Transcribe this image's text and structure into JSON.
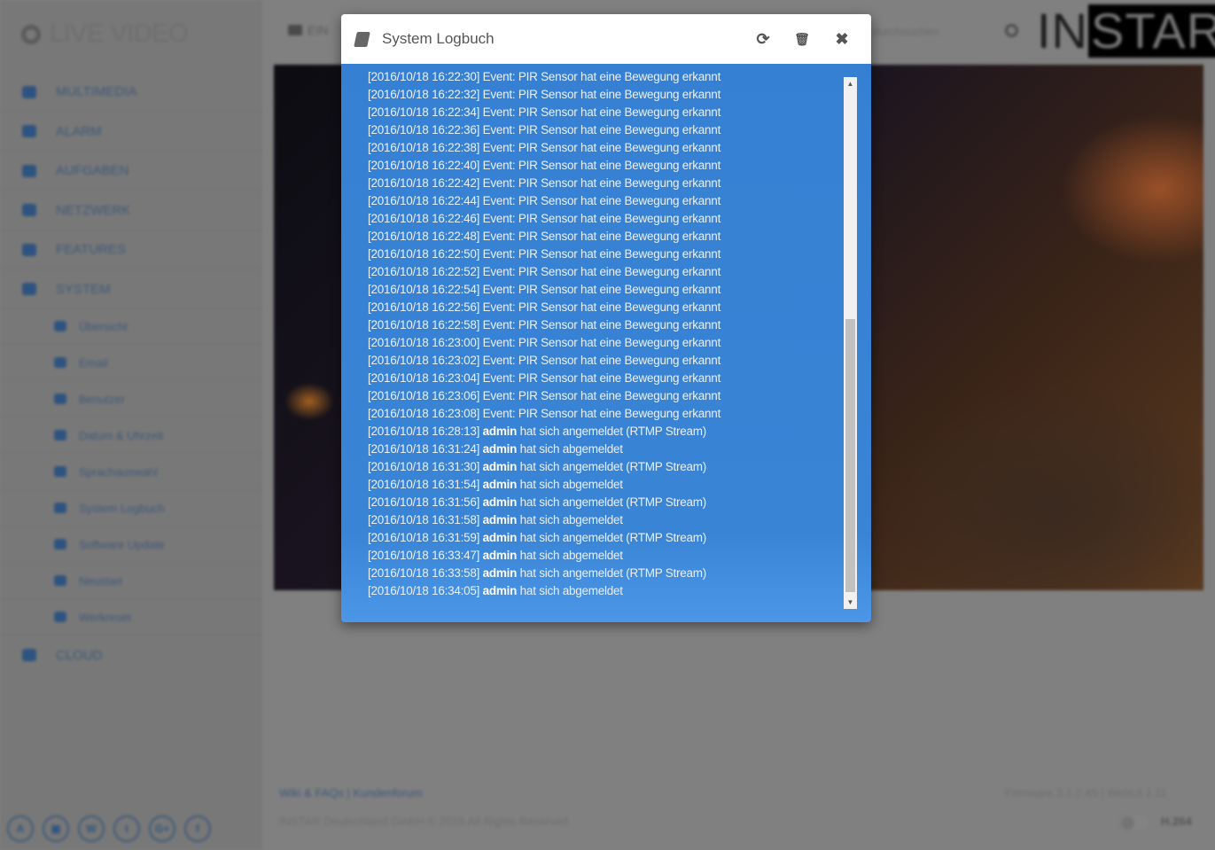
{
  "sidebar": {
    "logo": "LIVE VIDEO",
    "items": [
      {
        "label": "MULTIMEDIA",
        "icon": "image-icon"
      },
      {
        "label": "ALARM",
        "icon": "bell-icon"
      },
      {
        "label": "AUFGABEN",
        "icon": "film-icon"
      },
      {
        "label": "NETZWERK",
        "icon": "sitemap-icon"
      },
      {
        "label": "FEATURES",
        "icon": "circle-icon"
      },
      {
        "label": "SYSTEM",
        "icon": "gear-icon"
      }
    ],
    "system_sub": [
      {
        "label": "Übersicht",
        "icon": "desktop-icon"
      },
      {
        "label": "Email",
        "icon": "envelope-icon"
      },
      {
        "label": "Benutzer",
        "icon": "user-icon"
      },
      {
        "label": "Datum & Uhrzeit",
        "icon": "clock-icon"
      },
      {
        "label": "Sprachauswahl",
        "icon": "globe-icon"
      },
      {
        "label": "System Logbuch",
        "icon": "book-icon"
      },
      {
        "label": "Software Update",
        "icon": "refresh-icon"
      },
      {
        "label": "Neustart",
        "icon": "power-icon"
      },
      {
        "label": "Werkreset",
        "icon": "wrench-icon"
      }
    ],
    "cloud": "CLOUD",
    "social": [
      "A",
      "▣",
      "W",
      "t",
      "G+",
      "f"
    ]
  },
  "topbar": {
    "tab": "EIN",
    "search": "durchsuchen",
    "brand_a": "IN",
    "brand_b": "STAR"
  },
  "footer": {
    "links": "Wiki & FAQs | Kundenforum",
    "copyright": "INSTAR Deutschland GmbH © 2016 All Rights Reserved",
    "version": "Firmware 3.1.2.45 | WebUI 1.11",
    "codec": "H.264"
  },
  "modal": {
    "title": "System Logbuch",
    "refresh_icon": "⟳",
    "trash_icon": "🗑",
    "close_icon": "✖",
    "log": [
      {
        "ts": "[2016/10/18 16:22:30]",
        "user": "",
        "msg": "Event: PIR Sensor hat eine Bewegung erkannt"
      },
      {
        "ts": "[2016/10/18 16:22:32]",
        "user": "",
        "msg": "Event: PIR Sensor hat eine Bewegung erkannt"
      },
      {
        "ts": "[2016/10/18 16:22:34]",
        "user": "",
        "msg": "Event: PIR Sensor hat eine Bewegung erkannt"
      },
      {
        "ts": "[2016/10/18 16:22:36]",
        "user": "",
        "msg": "Event: PIR Sensor hat eine Bewegung erkannt"
      },
      {
        "ts": "[2016/10/18 16:22:38]",
        "user": "",
        "msg": "Event: PIR Sensor hat eine Bewegung erkannt"
      },
      {
        "ts": "[2016/10/18 16:22:40]",
        "user": "",
        "msg": "Event: PIR Sensor hat eine Bewegung erkannt"
      },
      {
        "ts": "[2016/10/18 16:22:42]",
        "user": "",
        "msg": "Event: PIR Sensor hat eine Bewegung erkannt"
      },
      {
        "ts": "[2016/10/18 16:22:44]",
        "user": "",
        "msg": "Event: PIR Sensor hat eine Bewegung erkannt"
      },
      {
        "ts": "[2016/10/18 16:22:46]",
        "user": "",
        "msg": "Event: PIR Sensor hat eine Bewegung erkannt"
      },
      {
        "ts": "[2016/10/18 16:22:48]",
        "user": "",
        "msg": "Event: PIR Sensor hat eine Bewegung erkannt"
      },
      {
        "ts": "[2016/10/18 16:22:50]",
        "user": "",
        "msg": "Event: PIR Sensor hat eine Bewegung erkannt"
      },
      {
        "ts": "[2016/10/18 16:22:52]",
        "user": "",
        "msg": "Event: PIR Sensor hat eine Bewegung erkannt"
      },
      {
        "ts": "[2016/10/18 16:22:54]",
        "user": "",
        "msg": "Event: PIR Sensor hat eine Bewegung erkannt"
      },
      {
        "ts": "[2016/10/18 16:22:56]",
        "user": "",
        "msg": "Event: PIR Sensor hat eine Bewegung erkannt"
      },
      {
        "ts": "[2016/10/18 16:22:58]",
        "user": "",
        "msg": "Event: PIR Sensor hat eine Bewegung erkannt"
      },
      {
        "ts": "[2016/10/18 16:23:00]",
        "user": "",
        "msg": "Event: PIR Sensor hat eine Bewegung erkannt"
      },
      {
        "ts": "[2016/10/18 16:23:02]",
        "user": "",
        "msg": "Event: PIR Sensor hat eine Bewegung erkannt"
      },
      {
        "ts": "[2016/10/18 16:23:04]",
        "user": "",
        "msg": "Event: PIR Sensor hat eine Bewegung erkannt"
      },
      {
        "ts": "[2016/10/18 16:23:06]",
        "user": "",
        "msg": "Event: PIR Sensor hat eine Bewegung erkannt"
      },
      {
        "ts": "[2016/10/18 16:23:08]",
        "user": "",
        "msg": "Event: PIR Sensor hat eine Bewegung erkannt"
      },
      {
        "ts": "[2016/10/18 16:28:13]",
        "user": "admin",
        "msg": "hat sich angemeldet (RTMP Stream)"
      },
      {
        "ts": "[2016/10/18 16:31:24]",
        "user": "admin",
        "msg": "hat sich abgemeldet"
      },
      {
        "ts": "[2016/10/18 16:31:30]",
        "user": "admin",
        "msg": "hat sich angemeldet (RTMP Stream)"
      },
      {
        "ts": "[2016/10/18 16:31:54]",
        "user": "admin",
        "msg": "hat sich abgemeldet"
      },
      {
        "ts": "[2016/10/18 16:31:56]",
        "user": "admin",
        "msg": "hat sich angemeldet (RTMP Stream)"
      },
      {
        "ts": "[2016/10/18 16:31:58]",
        "user": "admin",
        "msg": "hat sich abgemeldet"
      },
      {
        "ts": "[2016/10/18 16:31:59]",
        "user": "admin",
        "msg": "hat sich angemeldet (RTMP Stream)"
      },
      {
        "ts": "[2016/10/18 16:33:47]",
        "user": "admin",
        "msg": "hat sich abgemeldet"
      },
      {
        "ts": "[2016/10/18 16:33:58]",
        "user": "admin",
        "msg": "hat sich angemeldet (RTMP Stream)"
      },
      {
        "ts": "[2016/10/18 16:34:05]",
        "user": "admin",
        "msg": "hat sich abgemeldet"
      }
    ],
    "scroll_position_percent": 100
  },
  "colors": {
    "modal_body": "#3a84d6",
    "accent_nav": "#2e5380"
  }
}
